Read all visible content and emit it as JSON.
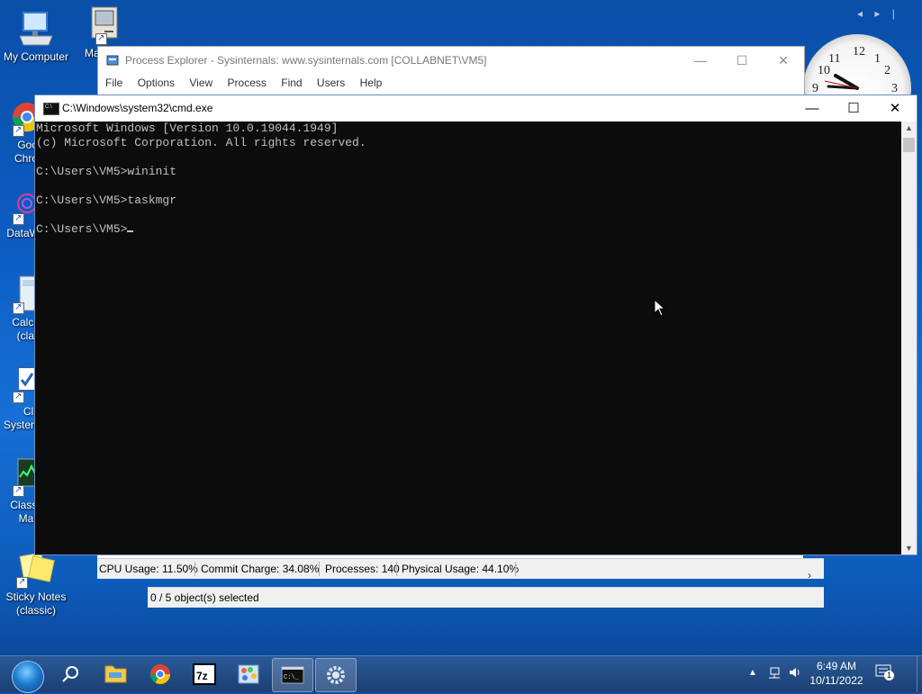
{
  "desktop": {
    "icons": [
      {
        "label": "My Computer"
      },
      {
        "label": "Ma"
      },
      {
        "label": "Goo\nChro"
      },
      {
        "label": "DataW"
      },
      {
        "label": "Calcu\n(clas"
      },
      {
        "label": "Cla\nSystem"
      },
      {
        "label": "Classi\nMan"
      },
      {
        "label": "Sticky Notes\n(classic)"
      }
    ]
  },
  "clock_gadget": {
    "nav_prev": "◂",
    "nav_next": "▸",
    "numerals": [
      "12",
      "11",
      "1",
      "2",
      "10",
      "3",
      "9"
    ],
    "time": "6:49"
  },
  "process_explorer": {
    "title": "Process Explorer - Sysinternals: www.sysinternals.com [COLLABNET\\VM5]",
    "menu": [
      "File",
      "Options",
      "View",
      "Process",
      "Find",
      "Users",
      "Help"
    ],
    "status": {
      "cpu": "CPU Usage: 11.50%",
      "commit": "Commit Charge: 34.08%",
      "processes": "Processes: 140",
      "physical": "Physical Usage: 44.10%"
    },
    "selection": "0 / 5 object(s) selected"
  },
  "cmd": {
    "title": "C:\\Windows\\system32\\cmd.exe",
    "lines": [
      "Microsoft Windows [Version 10.0.19044.1949]",
      "(c) Microsoft Corporation. All rights reserved.",
      "",
      "C:\\Users\\VM5>wininit",
      "",
      "C:\\Users\\VM5>taskmgr",
      "",
      "C:\\Users\\VM5>"
    ]
  },
  "taskbar": {
    "items": [
      "start",
      "search",
      "file-explorer",
      "chrome",
      "7zip",
      "paint",
      "cmd",
      "settings"
    ],
    "clock_time": "6:49 AM",
    "clock_date": "10/11/2022",
    "notification_count": "1"
  },
  "colors": {
    "desktop_bg": "#0c5cc2",
    "cmd_bg": "#0c0c0c",
    "cmd_fg": "#c0c0c0",
    "taskbar": "#1b3f72"
  }
}
